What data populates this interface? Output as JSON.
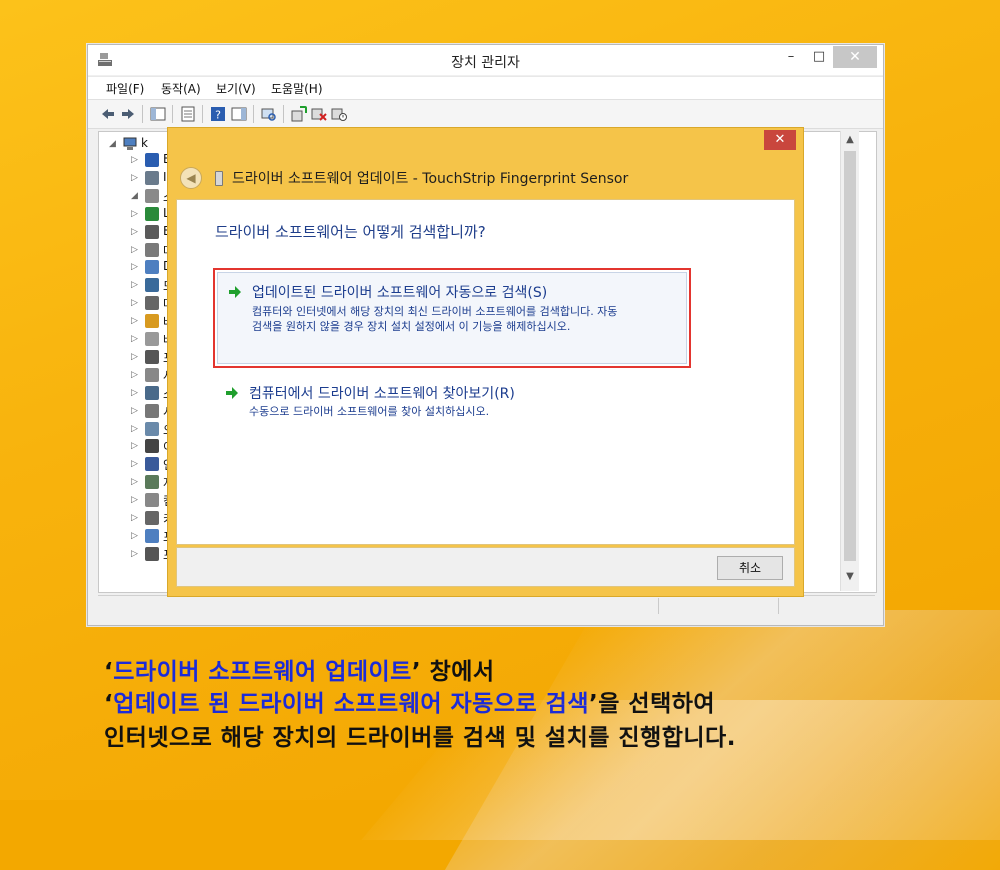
{
  "window": {
    "title": "장치 관리자",
    "minimize": "–",
    "maximize": "□",
    "close": "✕"
  },
  "menu": [
    "파일(F)",
    "동작(A)",
    "보기(V)",
    "도움말(H)"
  ],
  "tree": {
    "root_label": "k",
    "items": [
      "B",
      "I",
      "소",
      "L",
      "E",
      "마",
      "D",
      "모",
      "마",
      "바",
      "배",
      "포",
      "사",
      "소",
      "시",
      "오",
      "이",
      "인",
      "저",
      "컴",
      "키",
      "프",
      "프"
    ]
  },
  "dialog": {
    "title": "드라이버 소프트웨어 업데이트 - TouchStrip Fingerprint Sensor",
    "question": "드라이버 소프트웨어는 어떻게 검색합니까?",
    "option1": {
      "heading": "업데이트된 드라이버 소프트웨어 자동으로 검색(S)",
      "desc_line1": "컴퓨터와 인터넷에서 해당 장치의 최신 드라이버 소프트웨어를 검색합니다. 자동",
      "desc_line2": "검색을 원하지 않을 경우 장치 설치 설정에서 이 기능을 해제하십시오."
    },
    "option2": {
      "heading": "컴퓨터에서 드라이버 소프트웨어 찾아보기(R)",
      "desc": "수동으로 드라이버 소프트웨어를 찾아 설치하십시오."
    },
    "cancel": "취소",
    "close": "✕"
  },
  "caption": {
    "line1_pre": "‘",
    "line1_hl": "드라이버 소프트웨어 업데이트",
    "line1_post": "’ 창에서",
    "line2_pre": "‘",
    "line2_hl": "업데이트 된 드라이버 소프트웨어 자동으로 검색",
    "line2_post": "’을 선택하여",
    "line3": "인터넷으로 해당 장치의 드라이버를 검색 및 설치를 진행합니다."
  },
  "colors": {
    "background": "#f3a800",
    "dialog_frame": "#f5c449",
    "highlight_text": "#1c2bd8",
    "option_box_border": "#e3352f",
    "link_text": "#1c3d8f"
  }
}
